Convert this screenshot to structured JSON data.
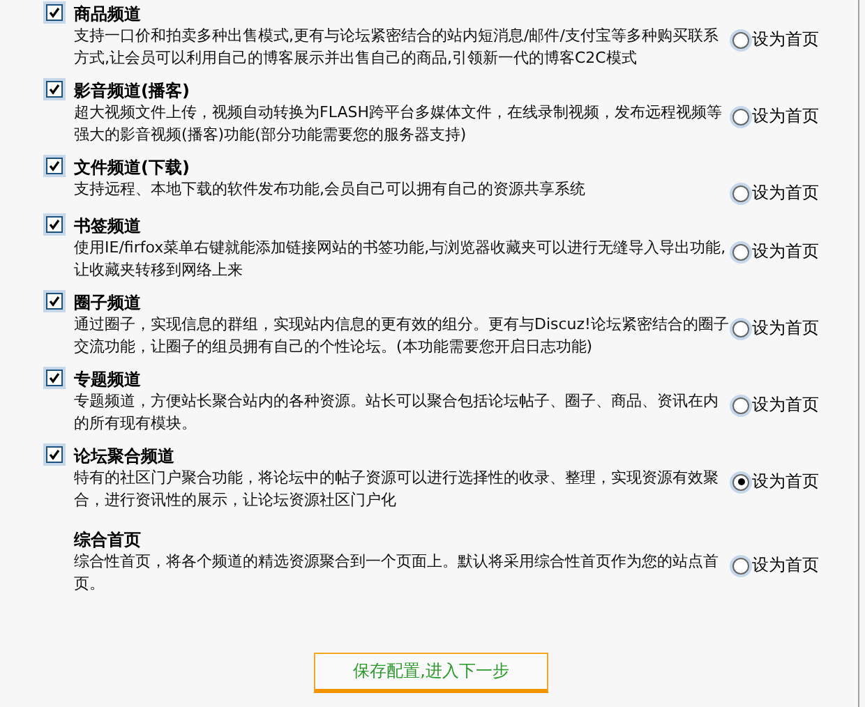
{
  "channels": [
    {
      "kind": "checkbox",
      "checked": true,
      "title": "商品频道",
      "description": "支持一口价和拍卖多种出售模式,更有与论坛紧密结合的站内短消息/邮件/支付宝等多种购买联系方式,让会员可以利用自己的博客展示并出售自己的商品,引领新一代的博客C2C模式",
      "home_label": "设为首页",
      "selected": false
    },
    {
      "kind": "checkbox",
      "checked": true,
      "title": "影音频道(播客)",
      "description": "超大视频文件上传，视频自动转换为FLASH跨平台多媒体文件，在线录制视频，发布远程视频等强大的影音视频(播客)功能(部分功能需要您的服务器支持)",
      "home_label": "设为首页",
      "selected": false
    },
    {
      "kind": "checkbox",
      "checked": true,
      "title": "文件频道(下载)",
      "description": "支持远程、本地下载的软件发布功能,会员自己可以拥有自己的资源共享系统",
      "home_label": "设为首页",
      "selected": false
    },
    {
      "kind": "checkbox",
      "checked": true,
      "title": "书签频道",
      "description": "使用IE/firfox菜单右键就能添加链接网站的书签功能,与浏览器收藏夹可以进行无缝导入导出功能,让收藏夹转移到网络上来",
      "home_label": "设为首页",
      "selected": false
    },
    {
      "kind": "checkbox",
      "checked": true,
      "title": "圈子频道",
      "description": "通过圈子，实现信息的群组，实现站内信息的更有效的组分。更有与Discuz!论坛紧密结合的圈子交流功能，让圈子的组员拥有自己的个性论坛。(本功能需要您开启日志功能)",
      "home_label": "设为首页",
      "selected": false
    },
    {
      "kind": "checkbox",
      "checked": true,
      "title": "专题频道",
      "description": "专题频道，方便站长聚合站内的各种资源。站长可以聚合包括论坛帖子、圈子、商品、资讯在内的所有现有模块。",
      "home_label": "设为首页",
      "selected": false
    },
    {
      "kind": "checkbox",
      "checked": true,
      "title": "论坛聚合频道",
      "description": "特有的社区门户聚合功能，将论坛中的帖子资源可以进行选择性的收录、整理，实现资源有效聚合，进行资讯性的展示，让论坛资源社区门户化",
      "home_label": "设为首页",
      "selected": true
    },
    {
      "kind": "plain",
      "title": "综合首页",
      "description": "综合性首页，将各个频道的精选资源聚合到一个页面上。默认将采用综合性首页作为您的站点首页。",
      "home_label": "设为首页",
      "selected": false
    }
  ],
  "submit_button": "保存配置,进入下一步"
}
